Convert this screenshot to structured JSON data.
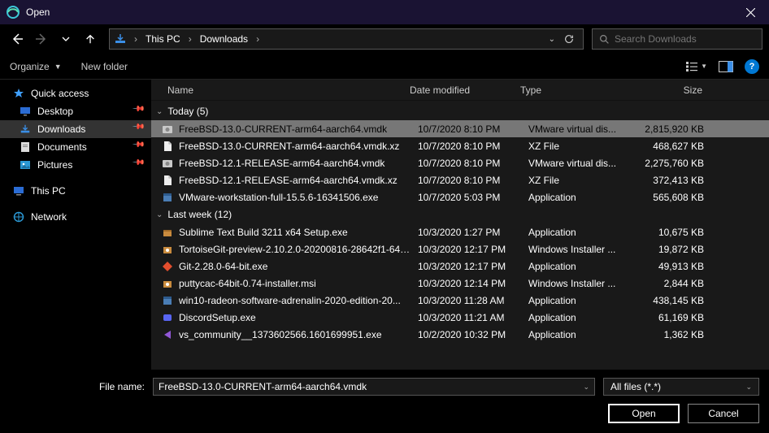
{
  "window": {
    "title": "Open"
  },
  "breadcrumb": {
    "seg1": "This PC",
    "seg2": "Downloads"
  },
  "search": {
    "placeholder": "Search Downloads"
  },
  "cmdbar": {
    "organize": "Organize",
    "newfolder": "New folder"
  },
  "navpane": {
    "quick_access": "Quick access",
    "desktop": "Desktop",
    "downloads": "Downloads",
    "documents": "Documents",
    "pictures": "Pictures",
    "this_pc": "This PC",
    "network": "Network"
  },
  "columns": {
    "name": "Name",
    "date": "Date modified",
    "type": "Type",
    "size": "Size"
  },
  "groups": [
    {
      "label": "Today (5)",
      "items": [
        {
          "icon": "disk",
          "name": "FreeBSD-13.0-CURRENT-arm64-aarch64.vmdk",
          "date": "10/7/2020 8:10 PM",
          "type": "VMware virtual dis...",
          "size": "2,815,920 KB",
          "selected": true
        },
        {
          "icon": "file",
          "name": "FreeBSD-13.0-CURRENT-arm64-aarch64.vmdk.xz",
          "date": "10/7/2020 8:10 PM",
          "type": "XZ File",
          "size": "468,627 KB"
        },
        {
          "icon": "disk",
          "name": "FreeBSD-12.1-RELEASE-arm64-aarch64.vmdk",
          "date": "10/7/2020 8:10 PM",
          "type": "VMware virtual dis...",
          "size": "2,275,760 KB"
        },
        {
          "icon": "file",
          "name": "FreeBSD-12.1-RELEASE-arm64-aarch64.vmdk.xz",
          "date": "10/7/2020 8:10 PM",
          "type": "XZ File",
          "size": "372,413 KB"
        },
        {
          "icon": "exe",
          "name": "VMware-workstation-full-15.5.6-16341506.exe",
          "date": "10/7/2020 5:03 PM",
          "type": "Application",
          "size": "565,608 KB"
        }
      ]
    },
    {
      "label": "Last week (12)",
      "items": [
        {
          "icon": "inst",
          "name": "Sublime Text Build 3211 x64 Setup.exe",
          "date": "10/3/2020 1:27 PM",
          "type": "Application",
          "size": "10,675 KB"
        },
        {
          "icon": "msi",
          "name": "TortoiseGit-preview-2.10.2.0-20200816-28642f1-64bi...",
          "date": "10/3/2020 12:17 PM",
          "type": "Windows Installer ...",
          "size": "19,872 KB"
        },
        {
          "icon": "git",
          "name": "Git-2.28.0-64-bit.exe",
          "date": "10/3/2020 12:17 PM",
          "type": "Application",
          "size": "49,913 KB"
        },
        {
          "icon": "msi",
          "name": "puttycac-64bit-0.74-installer.msi",
          "date": "10/3/2020 12:14 PM",
          "type": "Windows Installer ...",
          "size": "2,844 KB"
        },
        {
          "icon": "exe",
          "name": "win10-radeon-software-adrenalin-2020-edition-20...",
          "date": "10/3/2020 11:28 AM",
          "type": "Application",
          "size": "438,145 KB"
        },
        {
          "icon": "disc",
          "name": "DiscordSetup.exe",
          "date": "10/3/2020 11:21 AM",
          "type": "Application",
          "size": "61,169 KB"
        },
        {
          "icon": "vs",
          "name": "vs_community__1373602566.1601699951.exe",
          "date": "10/2/2020 10:32 PM",
          "type": "Application",
          "size": "1,362 KB"
        }
      ]
    }
  ],
  "footer": {
    "filename_label": "File name:",
    "filename_value": "FreeBSD-13.0-CURRENT-arm64-aarch64.vmdk",
    "filter": "All files (*.*)",
    "open": "Open",
    "cancel": "Cancel"
  }
}
